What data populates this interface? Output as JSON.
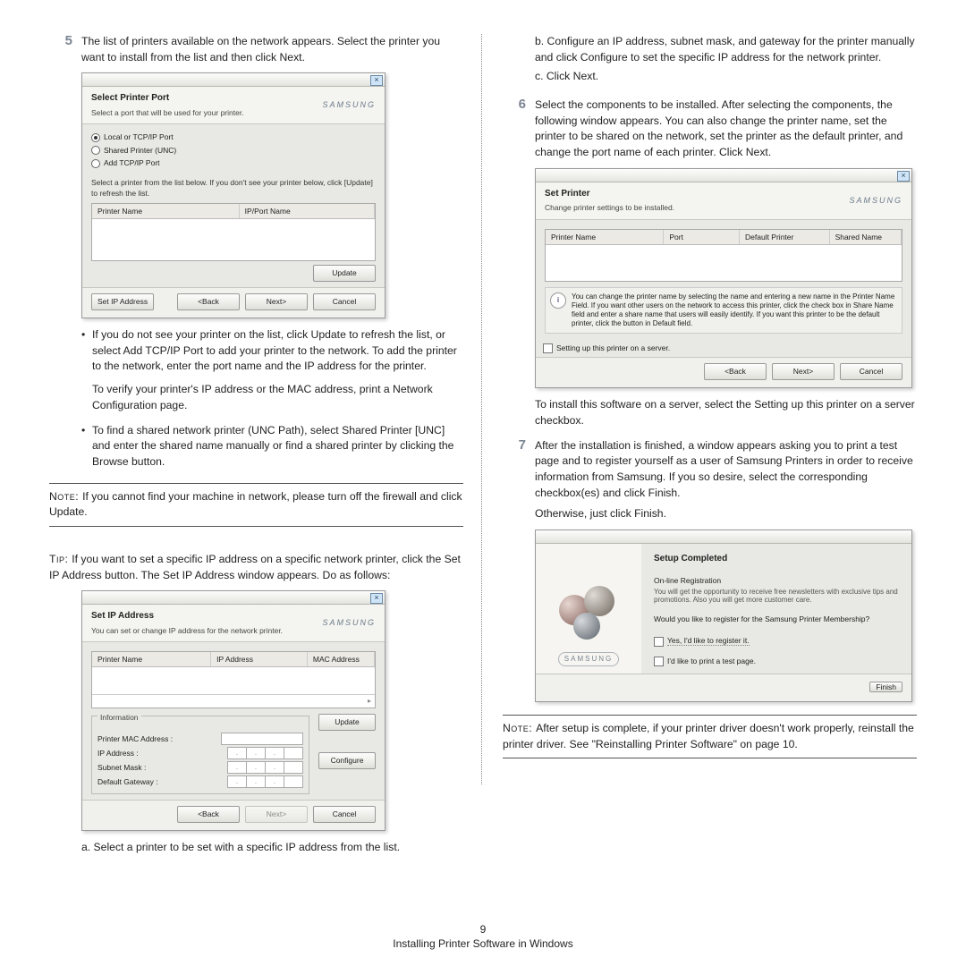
{
  "step5": {
    "num": "5",
    "text": "The list of printers available on the network appears. Select the printer you want to install from the list and then click Next."
  },
  "dlg1": {
    "title": "Select Printer Port",
    "subtitle": "Select a port that will be used for your printer.",
    "logo": "SAMSUNG",
    "r1": "Local or TCP/IP Port",
    "r2": "Shared Printer (UNC)",
    "r3": "Add TCP/IP Port",
    "hint": "Select a printer from the list below. If you don't see your printer below, click [Update] to refresh the list.",
    "col1": "Printer Name",
    "col2": "IP/Port Name",
    "update": "Update",
    "setip": "Set IP Address",
    "back": "<Back",
    "next": "Next>",
    "cancel": "Cancel"
  },
  "bul1a": "If you do not see your printer on the list, click Update to refresh the list, or select Add TCP/IP Port to add your printer to the network. To add the printer to the network, enter the port name and the IP address for the printer.",
  "bul1a2": "To verify your printer's IP address or the MAC address, print a Network Configuration page.",
  "bul1b": "To find a shared network printer (UNC Path), select Shared Printer [UNC] and enter the shared name manually or find a shared printer by clicking the Browse button.",
  "note1": "If you cannot find your machine in network, please turn off the firewall and click Update.",
  "note1_label": "Note: ",
  "tip_label": "Tip: ",
  "tip_text": "If you want to set a specific IP address on a specific network printer, click the Set IP Address button. The Set IP Address window appears. Do as follows:",
  "dlg2": {
    "title": "Set IP Address",
    "subtitle": "You can set or change IP address for the network printer.",
    "logo": "SAMSUNG",
    "col1": "Printer Name",
    "col2": "IP Address",
    "col3": "MAC Address",
    "info_leg": "Information",
    "mac": "Printer MAC Address :",
    "ip": "IP Address :",
    "subnet": "Subnet Mask :",
    "gw": "Default Gateway :",
    "update": "Update",
    "configure": "Configure",
    "back": "<Back",
    "next": "Next>",
    "cancel": "Cancel"
  },
  "sub_a": "a. Select a printer to be set with a specific IP address from the list.",
  "sub_b": "b. Configure an IP address, subnet mask, and gateway for the printer manually and click Configure to set the specific IP address for the network printer.",
  "sub_c": "c. Click Next.",
  "step6": {
    "num": "6",
    "text": "Select the components to be installed. After selecting the components, the following window appears. You can also change the printer name, set the printer to be shared on the network, set the printer as the default printer, and change the port name of each printer. Click Next."
  },
  "dlg3": {
    "title": "Set Printer",
    "subtitle": "Change printer settings to be installed.",
    "logo": "SAMSUNG",
    "c1": "Printer Name",
    "c2": "Port",
    "c3": "Default Printer",
    "c4": "Shared Name",
    "note": "You can change the printer name by selecting the name and entering a new name in the Printer Name Field. If you want other users on the network to access this printer, click the check box in Share Name field and enter a share name that users will easily identify. If you want this printer to be the default printer, click the button in Default field.",
    "chk": "Setting up this printer on a server.",
    "back": "<Back",
    "next": "Next>",
    "cancel": "Cancel"
  },
  "after6": "To install this software on a server, select the Setting up this printer on a server checkbox.",
  "step7": {
    "num": "7",
    "text": "After the installation is finished, a window appears asking you to print a test page and to register yourself as a user of Samsung Printers in order to receive information from Samsung. If you so desire, select the corresponding checkbox(es) and click Finish."
  },
  "step7b": "Otherwise, just click Finish.",
  "dlg4": {
    "title": "Setup Completed",
    "reg_h": "On-line Registration",
    "reg_t": "You will get the opportunity to receive free newsletters with exclusive tips and promotions. Also you will get more customer care.",
    "q": "Would you like to register for the Samsung Printer Membership?",
    "opt1": "Yes, I'd like to register it.",
    "opt2": "I'd like to print a test page.",
    "slogo": "SAMSUNG",
    "finish": "Finish"
  },
  "note2_label": "Note: ",
  "note2": "After setup is complete, if your printer driver doesn't work properly, reinstall the printer driver. See \"Reinstalling Printer Software\" on page 10.",
  "pagenum": "9",
  "footer": "Installing Printer Software in Windows"
}
